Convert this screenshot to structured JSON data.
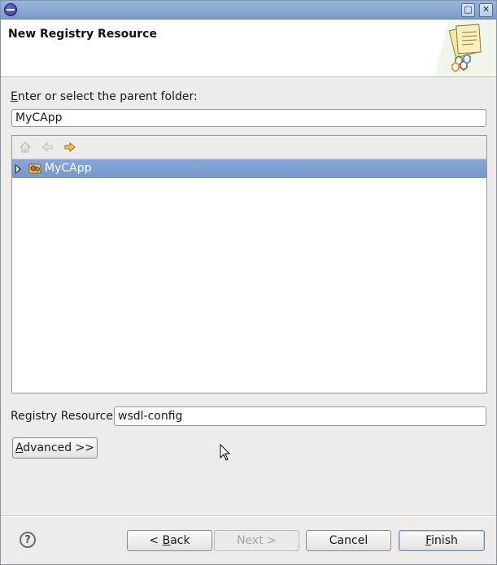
{
  "window": {
    "maximize_glyph": "□",
    "close_glyph": "✕"
  },
  "header": {
    "title": "New Registry Resource"
  },
  "parent_folder": {
    "label_accel": "E",
    "label_rest": "nter or select the parent folder:",
    "value": "MyCApp"
  },
  "tree": {
    "toolbar_icons": [
      "home-icon",
      "back-arrow-icon",
      "forward-arrow-icon"
    ],
    "items": [
      {
        "label": "MyCApp",
        "icon": "project-icon",
        "selected": true,
        "expanded": false
      }
    ]
  },
  "resource": {
    "label": "Registry Resource",
    "value": "wsdl-config"
  },
  "advanced_button": {
    "accel": "A",
    "rest": "dvanced >>"
  },
  "footer": {
    "help_glyph": "?",
    "back": {
      "prefix": "< ",
      "accel": "B",
      "rest": "ack"
    },
    "next": {
      "label": "Next >"
    },
    "cancel": {
      "label": "Cancel"
    },
    "finish": {
      "accel": "F",
      "rest": "inish"
    }
  },
  "colors": {
    "selection": "#7598ca",
    "titlebar": "#8aa7d0",
    "dialog_bg": "#edeceb"
  }
}
